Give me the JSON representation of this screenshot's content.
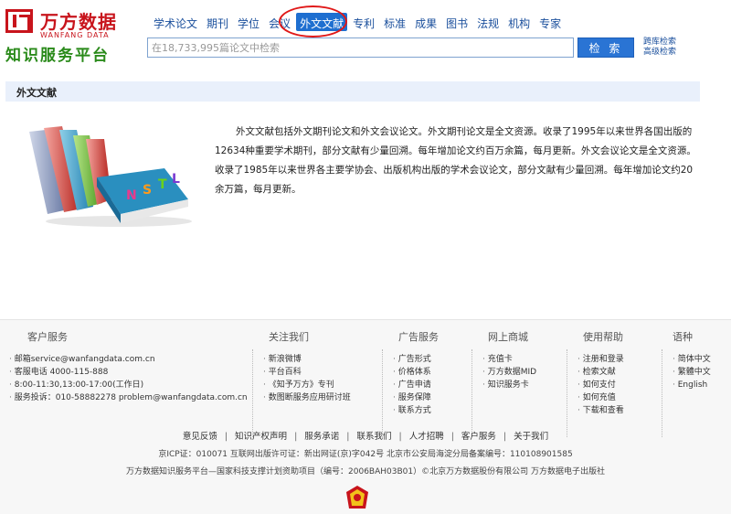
{
  "logo": {
    "title": "万方数据",
    "subtitle": "WANFANG DATA",
    "slogan": "知识服务平台"
  },
  "nav": {
    "items": [
      "学术论文",
      "期刊",
      "学位",
      "会议",
      "外文文献",
      "专利",
      "标准",
      "成果",
      "图书",
      "法规",
      "机构",
      "专家"
    ],
    "active_index": 4
  },
  "search": {
    "placeholder": "在18,733,995篇论文中检索",
    "button_label": "检 索",
    "cross_db_link": "跨库检索",
    "advanced_link": "高级检索"
  },
  "section": {
    "title": "外文文献",
    "description": "外文文献包括外文期刊论文和外文会议论文。外文期刊论文是全文资源。收录了1995年以来世界各国出版的12634种重要学术期刊，部分文献有少量回溯。每年增加论文约百万余篇，每月更新。外文会议论文是全文资源。收录了1985年以来世界各主要学协会、出版机构出版的学术会议论文，部分文献有少量回溯。每年增加论文约20余万篇，每月更新。"
  },
  "footer": {
    "columns": [
      {
        "title": "客户服务",
        "items": [
          "邮箱service@wanfangdata.com.cn",
          "客服电话 4000-115-888",
          "8:00-11:30,13:00-17:00(工作日)",
          "服务投诉：010-58882278 problem@wanfangdata.com.cn"
        ]
      },
      {
        "title": "关注我们",
        "items": [
          "新浪微博",
          "平台百科",
          "《知予万方》专刊",
          "数图断服务应用研讨班"
        ]
      },
      {
        "title": "广告服务",
        "items": [
          "广告形式",
          "价格体系",
          "广告申请",
          "服务保障",
          "联系方式"
        ]
      },
      {
        "title": "网上商城",
        "items": [
          "充值卡",
          "万方数据MID",
          "知识服务卡"
        ]
      },
      {
        "title": "使用帮助",
        "items": [
          "注册和登录",
          "检索文献",
          "如何支付",
          "如何充值",
          "下载和查看"
        ]
      },
      {
        "title": "语种",
        "items": [
          "简体中文",
          "繁體中文",
          "English"
        ]
      }
    ],
    "links": [
      "意见反馈",
      "知识产权声明",
      "服务承诺",
      "联系我们",
      "人才招聘",
      "客户服务",
      "关于我们"
    ],
    "icp_line": "京ICP证：010071   互联网出版许可证：新出网证(京)字042号   北京市公安局海淀分局备案编号：110108901585",
    "project_line": "万方数据知识服务平台—国家科技支撑计划资助项目（编号：2006BAH03B01）©北京万方数据股份有限公司   万方数据电子出版社"
  },
  "colors": {
    "brand_red": "#c8141c",
    "brand_green": "#2a8a1a",
    "nav_blue": "#1a4f9c",
    "active_blue": "#1e6fd0",
    "highlight_ring": "#e01818"
  }
}
